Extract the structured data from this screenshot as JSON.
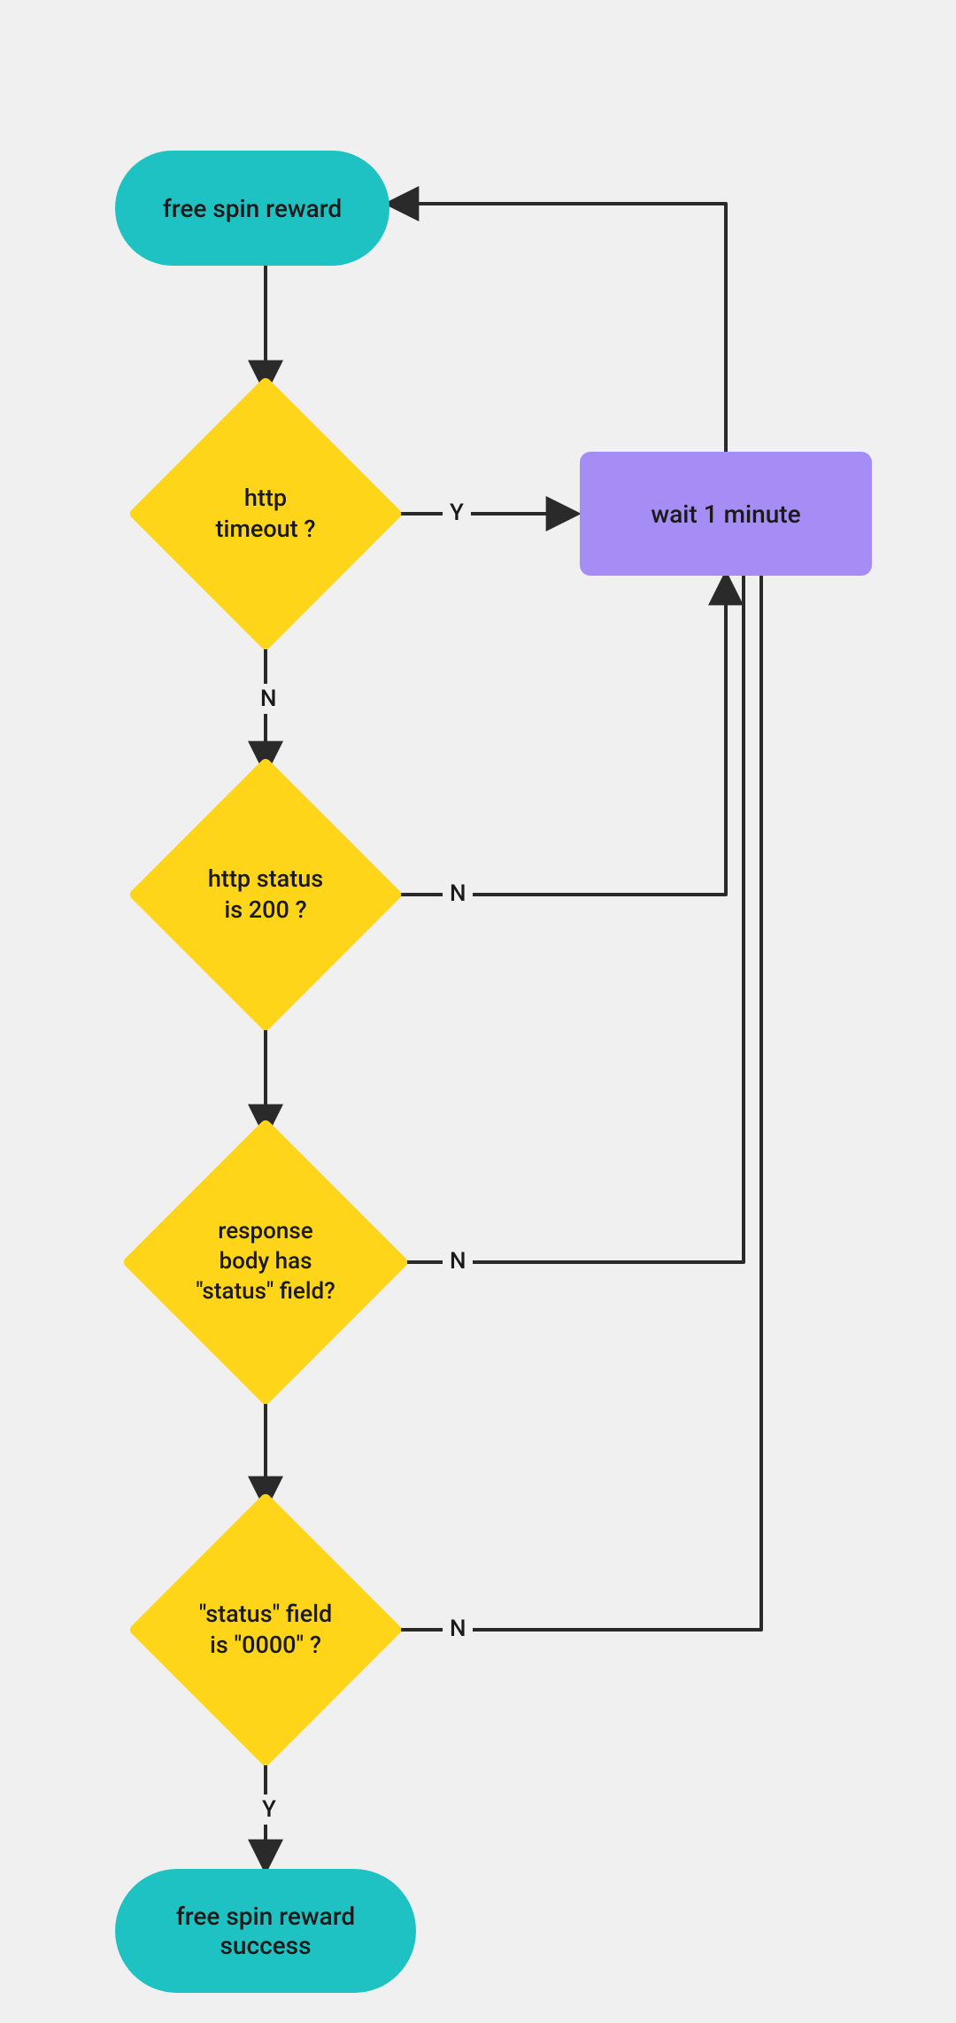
{
  "chart_data": {
    "type": "flowchart",
    "nodes": [
      {
        "id": "start",
        "type": "terminator",
        "label": "free spin reward"
      },
      {
        "id": "d1",
        "type": "decision",
        "label": "http\ntimeout ?"
      },
      {
        "id": "d2",
        "type": "decision",
        "label": "http status\nis 200 ?"
      },
      {
        "id": "d3",
        "type": "decision",
        "label": "response\nbody has\n\"status\" field?"
      },
      {
        "id": "d4",
        "type": "decision",
        "label": "\"status\" field\nis \"0000\" ?"
      },
      {
        "id": "wait",
        "type": "process",
        "label": "wait 1 minute"
      },
      {
        "id": "success",
        "type": "terminator",
        "label": "free spin reward\nsuccess"
      }
    ],
    "edges": [
      {
        "from": "start",
        "to": "d1",
        "label": null
      },
      {
        "from": "d1",
        "to": "wait",
        "label": "Y"
      },
      {
        "from": "d1",
        "to": "d2",
        "label": "N"
      },
      {
        "from": "d2",
        "to": "wait",
        "label": "N"
      },
      {
        "from": "d2",
        "to": "d3",
        "label": null
      },
      {
        "from": "d3",
        "to": "wait",
        "label": "N"
      },
      {
        "from": "d3",
        "to": "d4",
        "label": null
      },
      {
        "from": "d4",
        "to": "wait",
        "label": "N"
      },
      {
        "from": "d4",
        "to": "success",
        "label": "Y"
      },
      {
        "from": "wait",
        "to": "start",
        "label": null
      }
    ]
  },
  "nodes": {
    "start": {
      "label": "free spin reward"
    },
    "d1": {
      "line1": "http",
      "line2": "timeout ?"
    },
    "d2": {
      "line1": "http status",
      "line2": "is 200 ?"
    },
    "d3": {
      "line1": "response",
      "line2": "body has",
      "line3": "\"status\" field?"
    },
    "d4": {
      "line1": "\"status\" field",
      "line2": "is \"0000\" ?"
    },
    "wait": {
      "label": "wait 1 minute"
    },
    "success": {
      "line1": "free spin reward",
      "line2": "success"
    }
  },
  "labels": {
    "Y": "Y",
    "N": "N"
  }
}
